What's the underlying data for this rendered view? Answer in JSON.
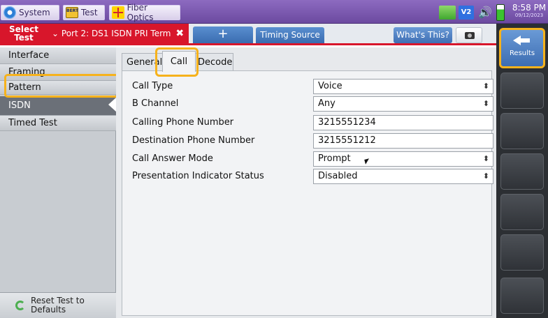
{
  "topbar": {
    "system_label": "System",
    "test_label": "Test",
    "bert_badge": "BERT",
    "fiber_label": "Fiber Optics",
    "v2_label": "V2",
    "time": "8:58 PM",
    "date": "09/12/2023"
  },
  "tabs": {
    "select_test": "Select Test",
    "port_tab": "Port 2: DS1 ISDN PRI Term",
    "add_tab": "+",
    "timing_source": "Timing Source",
    "whats_this": "What's This?"
  },
  "right_panel": {
    "results_label": "Results"
  },
  "sidebar": {
    "items": [
      {
        "label": "Interface"
      },
      {
        "label": "Framing"
      },
      {
        "label": "Pattern"
      },
      {
        "label": "ISDN"
      },
      {
        "label": "Timed Test"
      }
    ],
    "active_index": 3,
    "reset_label": "Reset Test to Defaults"
  },
  "subtabs": {
    "general": "General",
    "call": "Call",
    "decode": "Decode",
    "active": "Call"
  },
  "form": {
    "call_type": {
      "label": "Call Type",
      "value": "Voice"
    },
    "b_channel": {
      "label": "B Channel",
      "value": "Any"
    },
    "calling_number": {
      "label": "Calling Phone Number",
      "value": "3215551234"
    },
    "destination_number": {
      "label": "Destination Phone Number",
      "value": "3215551212"
    },
    "call_answer_mode": {
      "label": "Call Answer Mode",
      "value": "Prompt"
    },
    "presentation_indicator": {
      "label": "Presentation Indicator Status",
      "value": "Disabled"
    }
  },
  "colors": {
    "accent_red": "#d8162b",
    "highlight": "#f6b21c",
    "topbar_purple": "#7a58b0",
    "tab_blue": "#4a7ec2"
  }
}
